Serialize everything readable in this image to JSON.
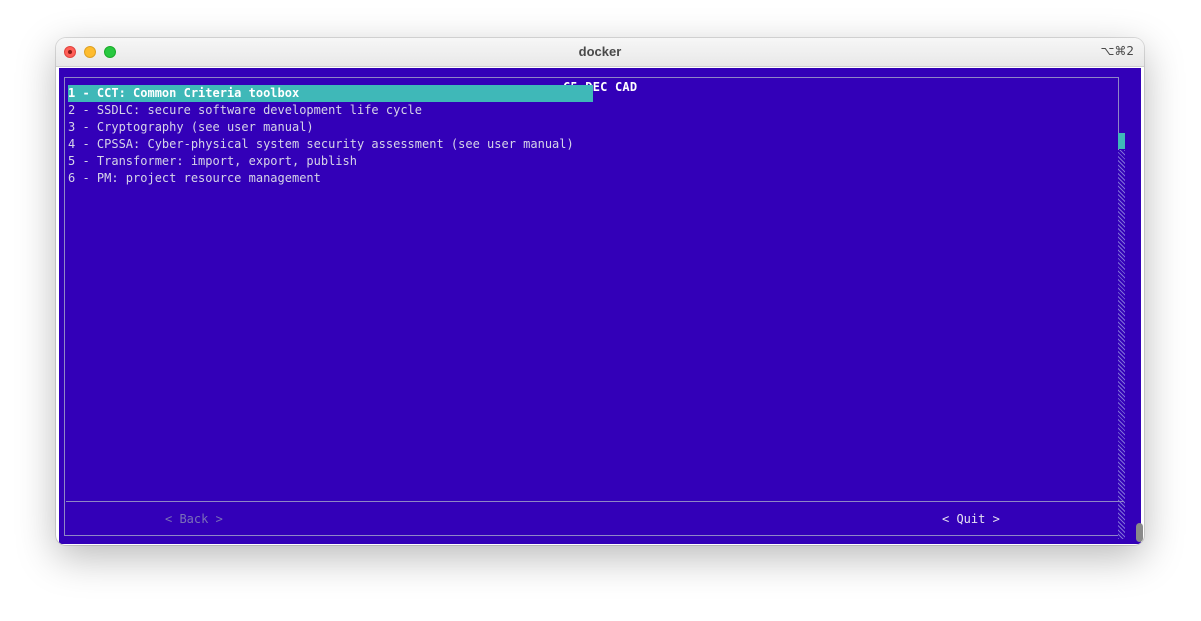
{
  "window": {
    "title": "docker",
    "shortcut": "⌥⌘2"
  },
  "dialog": {
    "title": "C5-DEC CAD",
    "menu_items": [
      "1 - CCT: Common Criteria toolbox",
      "2 - SSDLC: secure software development life cycle",
      "3 - Cryptography (see user manual)",
      "4 - CPSSA: Cyber-physical system security assessment (see user manual)",
      "5 - Transformer: import, export, publish",
      "6 - PM: project resource management"
    ],
    "selected_index": 0,
    "buttons": {
      "back": "< Back >",
      "quit": "< Quit >"
    }
  },
  "colors": {
    "background": "#3300b8",
    "highlight": "#3fb8b8",
    "text": "#d6d4e8"
  }
}
